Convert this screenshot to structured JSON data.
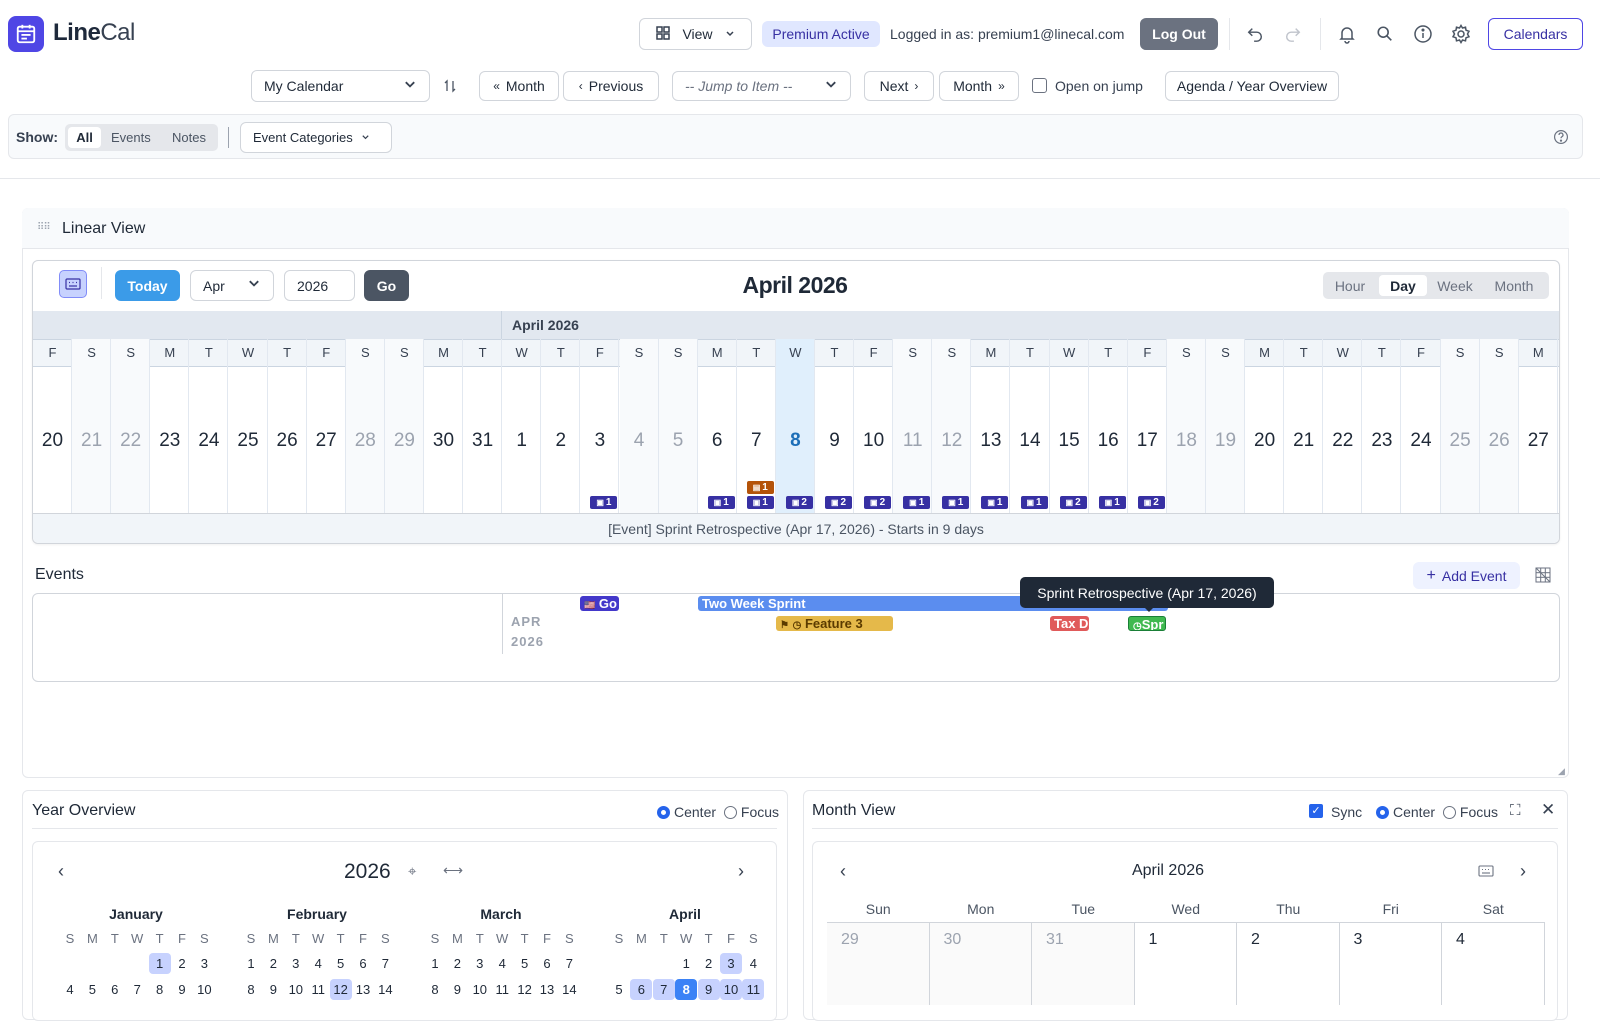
{
  "app": {
    "name_bold": "Line",
    "name_light": "Cal"
  },
  "header": {
    "view_label": "View",
    "premium_badge": "Premium Active",
    "logged_in": "Logged in as: premium1@linecal.com",
    "logout_label": "Log Out",
    "calendars_label": "Calendars"
  },
  "nav": {
    "calendar_select": "My Calendar",
    "prev_month": "Month",
    "previous": "Previous",
    "jump_placeholder": "-- Jump to Item --",
    "next": "Next",
    "next_month": "Month",
    "open_on_jump": "Open on jump",
    "agenda": "Agenda / Year Overview"
  },
  "show": {
    "label": "Show:",
    "all": "All",
    "events": "Events",
    "notes": "Notes",
    "categories": "Event Categories"
  },
  "linear": {
    "title": "Linear View",
    "today": "Today",
    "month_select": "Apr",
    "year_input": "2026",
    "go": "Go",
    "heading": "April 2026",
    "scales": [
      "Hour",
      "Day",
      "Week",
      "Month"
    ],
    "active_scale": "Day",
    "month_band": "April 2026",
    "days": [
      {
        "dow": "F",
        "d": "20",
        "we": false
      },
      {
        "dow": "S",
        "d": "21",
        "we": true
      },
      {
        "dow": "S",
        "d": "22",
        "we": true
      },
      {
        "dow": "M",
        "d": "23",
        "we": false
      },
      {
        "dow": "T",
        "d": "24",
        "we": false
      },
      {
        "dow": "W",
        "d": "25",
        "we": false
      },
      {
        "dow": "T",
        "d": "26",
        "we": false
      },
      {
        "dow": "F",
        "d": "27",
        "we": false
      },
      {
        "dow": "S",
        "d": "28",
        "we": true
      },
      {
        "dow": "S",
        "d": "29",
        "we": true
      },
      {
        "dow": "M",
        "d": "30",
        "we": false
      },
      {
        "dow": "T",
        "d": "31",
        "we": false
      },
      {
        "dow": "W",
        "d": "1",
        "we": false
      },
      {
        "dow": "T",
        "d": "2",
        "we": false
      },
      {
        "dow": "F",
        "d": "3",
        "we": false
      },
      {
        "dow": "S",
        "d": "4",
        "we": true
      },
      {
        "dow": "S",
        "d": "5",
        "we": true
      },
      {
        "dow": "M",
        "d": "6",
        "we": false
      },
      {
        "dow": "T",
        "d": "7",
        "we": false
      },
      {
        "dow": "W",
        "d": "8",
        "we": false
      },
      {
        "dow": "T",
        "d": "9",
        "we": false
      },
      {
        "dow": "F",
        "d": "10",
        "we": false
      },
      {
        "dow": "S",
        "d": "11",
        "we": true
      },
      {
        "dow": "S",
        "d": "12",
        "we": true
      },
      {
        "dow": "M",
        "d": "13",
        "we": false
      },
      {
        "dow": "T",
        "d": "14",
        "we": false
      },
      {
        "dow": "W",
        "d": "15",
        "we": false
      },
      {
        "dow": "T",
        "d": "16",
        "we": false
      },
      {
        "dow": "F",
        "d": "17",
        "we": false
      },
      {
        "dow": "S",
        "d": "18",
        "we": true
      },
      {
        "dow": "S",
        "d": "19",
        "we": true
      },
      {
        "dow": "M",
        "d": "20",
        "we": false
      },
      {
        "dow": "T",
        "d": "21",
        "we": false
      },
      {
        "dow": "W",
        "d": "22",
        "we": false
      },
      {
        "dow": "T",
        "d": "23",
        "we": false
      },
      {
        "dow": "F",
        "d": "24",
        "we": false
      },
      {
        "dow": "S",
        "d": "25",
        "we": true
      },
      {
        "dow": "S",
        "d": "26",
        "we": true
      },
      {
        "dow": "M",
        "d": "27",
        "we": false
      }
    ],
    "today_index": 19,
    "counts": [
      {
        "i": 14,
        "n": "1"
      },
      {
        "i": 17,
        "n": "1"
      },
      {
        "i": 18,
        "n": "1"
      },
      {
        "i": 19,
        "n": "2"
      },
      {
        "i": 20,
        "n": "2"
      },
      {
        "i": 21,
        "n": "2"
      },
      {
        "i": 22,
        "n": "1"
      },
      {
        "i": 23,
        "n": "1"
      },
      {
        "i": 24,
        "n": "1"
      },
      {
        "i": 25,
        "n": "1"
      },
      {
        "i": 26,
        "n": "2"
      },
      {
        "i": 27,
        "n": "1"
      },
      {
        "i": 28,
        "n": "2"
      }
    ],
    "note_count": {
      "i": 18,
      "n": "1"
    },
    "status": "[Event] Sprint Retrospective (Apr 17, 2026) - Starts in 9 days"
  },
  "events": {
    "title": "Events",
    "add": "Add Event",
    "month_label": "APR",
    "year_label": "2026",
    "bars": [
      {
        "label": "Go",
        "color": "#4338ca"
      },
      {
        "label": "Two Week Sprint",
        "color": "#5b8def"
      },
      {
        "label": "Feature 3",
        "color": "#e5b94a"
      },
      {
        "label": "Tax D",
        "color": "#e05a5a"
      },
      {
        "label": "Spr",
        "color": "#3fb950"
      }
    ],
    "tooltip": "Sprint Retrospective (Apr 17, 2026)"
  },
  "year_overview": {
    "title": "Year Overview",
    "center": "Center",
    "focus": "Focus",
    "year": "2026",
    "weekday_letters": [
      "S",
      "M",
      "T",
      "W",
      "T",
      "F",
      "S"
    ],
    "months": [
      {
        "name": "January",
        "rows": [
          [
            "",
            "",
            "",
            "",
            "1",
            "2",
            "3"
          ],
          [
            "4",
            "5",
            "6",
            "7",
            "8",
            "9",
            "10"
          ]
        ],
        "hl": [
          "1"
        ]
      },
      {
        "name": "February",
        "rows": [
          [
            "1",
            "2",
            "3",
            "4",
            "5",
            "6",
            "7"
          ],
          [
            "8",
            "9",
            "10",
            "11",
            "12",
            "13",
            "14"
          ]
        ],
        "hl": [
          "12"
        ]
      },
      {
        "name": "March",
        "rows": [
          [
            "1",
            "2",
            "3",
            "4",
            "5",
            "6",
            "7"
          ],
          [
            "8",
            "9",
            "10",
            "11",
            "12",
            "13",
            "14"
          ]
        ],
        "hl": []
      },
      {
        "name": "April",
        "rows": [
          [
            "",
            "",
            "",
            "1",
            "2",
            "3",
            "4"
          ],
          [
            "5",
            "6",
            "7",
            "8",
            "9",
            "10",
            "11"
          ]
        ],
        "hl": [
          "3",
          "6",
          "7",
          "9",
          "10",
          "11"
        ],
        "today": "8"
      }
    ]
  },
  "month_view": {
    "title": "Month View",
    "sync": "Sync",
    "center": "Center",
    "focus": "Focus",
    "heading": "April 2026",
    "weekdays": [
      "Sun",
      "Mon",
      "Tue",
      "Wed",
      "Thu",
      "Fri",
      "Sat"
    ],
    "first_row": [
      {
        "d": "29",
        "muted": true
      },
      {
        "d": "30",
        "muted": true
      },
      {
        "d": "31",
        "muted": true
      },
      {
        "d": "1",
        "muted": false
      },
      {
        "d": "2",
        "muted": false
      },
      {
        "d": "3",
        "muted": false
      },
      {
        "d": "4",
        "muted": false
      }
    ]
  },
  "colors": {
    "accent": "#4f46e5",
    "today_blue": "#3b9be8",
    "count_badge": "#3730a3"
  }
}
